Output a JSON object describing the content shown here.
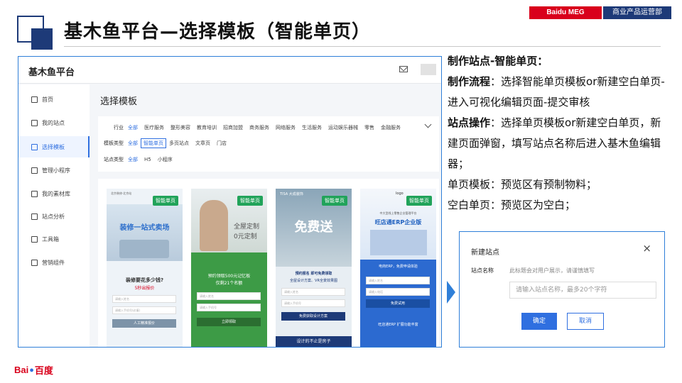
{
  "header": {
    "title": "基木鱼平台—选择模板（智能单页）",
    "tag_left": "Baidu MEG",
    "tag_right": "商业产品运营部"
  },
  "window": {
    "brand": "基木鱼平台",
    "sidebar": [
      {
        "label": "首页",
        "icon": "home-icon"
      },
      {
        "label": "我的站点",
        "icon": "site-icon"
      },
      {
        "label": "选择模板",
        "icon": "template-icon"
      },
      {
        "label": "管理小程序",
        "icon": "miniapp-icon"
      },
      {
        "label": "我的素材库",
        "icon": "image-icon"
      },
      {
        "label": "站点分析",
        "icon": "chart-icon"
      },
      {
        "label": "工具箱",
        "icon": "toolbox-icon"
      },
      {
        "label": "营销组件",
        "icon": "component-icon"
      }
    ],
    "main_title": "选择模板",
    "filters": {
      "industry": {
        "label": "行业",
        "options": [
          "全部",
          "医疗服务",
          "整形美容",
          "教育培训",
          "招商加盟",
          "商务服务",
          "网络服务",
          "生活服务",
          "运动娱乐器械",
          "零售",
          "金融服务"
        ]
      },
      "template_type": {
        "label": "模板类型",
        "options": [
          "全部",
          "智能单页",
          "多页站点",
          "文章页",
          "门店"
        ]
      },
      "site_type": {
        "label": "站点类型",
        "options": [
          "全部",
          "H5",
          "小程序"
        ]
      }
    },
    "cards": [
      {
        "badge": "智能单页",
        "top_text": "北京装修·北京站",
        "headline": "装修一站式卖场",
        "sub": "装修要花多少钱?",
        "sub2": "5秒出报价",
        "f1": "请输入姓名",
        "f2": "请输入手机号(必填)",
        "btn": "人工精准报价"
      },
      {
        "badge": "智能单页",
        "headline": "全屋定制",
        "headline2": "0元定制",
        "sub": "预约领取500元记忆板",
        "sub2": "仅剩21个名额",
        "f1": "请输入姓名",
        "f2": "请输入手机号",
        "btn": "立即领取"
      },
      {
        "badge": "智能单页",
        "top_text": "TISA 大成装饰",
        "headline": "免费送",
        "sub": "预约报名 即可免费领取",
        "sub2": "全屋设计方案、VR全景效果图",
        "f1": "请输入姓名",
        "f2": "请输入手机号",
        "btn": "免费获取设计方案",
        "bottom": "设计的不止是房子"
      },
      {
        "badge": "智能单页",
        "top_text": "logo",
        "headline": "旺店通ERP企业版",
        "sub": "中大型线上零售企业管理平台",
        "sub2": "电商ERP，免费申请体验",
        "f1": "请输入姓名",
        "f2": "请输入电话",
        "btn": "免费试用",
        "bottom": "旺店通ERP 扩展功能丰富"
      }
    ]
  },
  "description": {
    "heading": "制作站点-智能单页：",
    "flow_label": "制作流程",
    "flow_text": "：选择智能单页模板or新建空白单页-进入可视化编辑页面-提交审核",
    "op_label": "站点操作",
    "op_text": "：选择单页模板or新建空白单页，新建页面弹窗，填写站点名称后进入基木鱼编辑器；",
    "line_template": "单页模板：预览区有预制物料；",
    "line_blank": "空白单页：预览区为空白；"
  },
  "dialog": {
    "title": "新建站点",
    "close": "×",
    "label": "站点名称",
    "hint": "此标题会对用户展示，请谨慎填写",
    "placeholder": "请输入站点名称，最多20个字符",
    "ok": "确定",
    "cancel": "取消"
  },
  "footer": {
    "bai": "Bai",
    "du": "百度"
  },
  "colors": {
    "brand_blue": "#1d3a78",
    "accent_blue": "#2f6fe0",
    "red": "#d9001b",
    "badge_green": "#21a35a"
  }
}
